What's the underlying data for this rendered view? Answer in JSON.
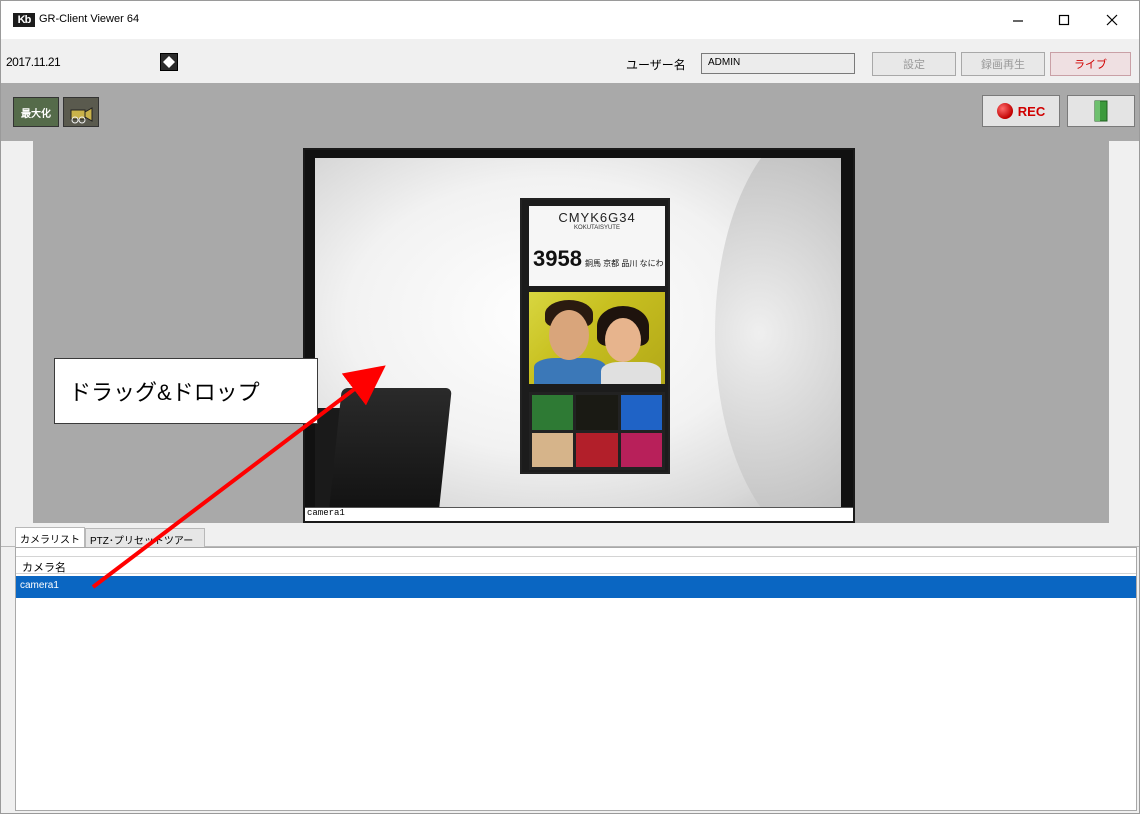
{
  "window": {
    "logo": "Kb",
    "title": "GR-Client Viewer 64",
    "minimize_glyph": "–",
    "maximize_glyph": "☐",
    "close_glyph": "✕"
  },
  "topbar": {
    "datetime": "2017.11.21",
    "username_label": "ユーザー名",
    "username_value": "ADMIN",
    "settings_label": "設定",
    "playback_label": "録画再生",
    "live_label": "ライブ"
  },
  "toolbar": {
    "maximize_label": "最大化",
    "rec_label": "REC"
  },
  "video": {
    "camera_label": "camera1",
    "chart_heading": "CMYK6G34",
    "chart_subheading": "KOKUTAISYUTE",
    "chart_number": "3958",
    "chart_number_text": "銅馬 京都 品川 なにわ"
  },
  "annotation": {
    "text": "ドラッグ&ドロップ"
  },
  "tabs": [
    {
      "label": "カメラリスト"
    },
    {
      "label": "PTZ･プリセットツアー"
    }
  ],
  "camera_list": {
    "header": "カメラ名",
    "rows": [
      "camera1"
    ]
  },
  "colors": {
    "selection": "#0a66c2",
    "annotation_arrow": "#ff0000",
    "rec": "#d00000",
    "toolbar_gray": "#a9a9a9"
  },
  "icons": {
    "clock": "diamond-settings-icon",
    "ptz": "ptz-camera-icon",
    "exit": "exit-door-icon",
    "rec": "record-dot-icon"
  }
}
